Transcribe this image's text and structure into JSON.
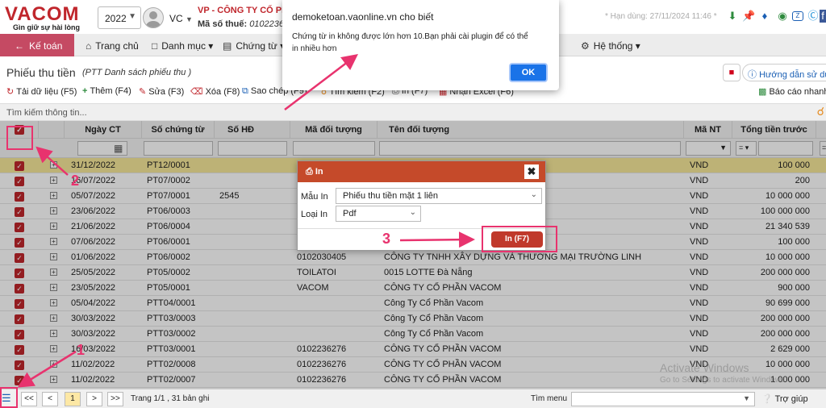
{
  "header": {
    "logo": "VACOM",
    "slogan": "Gìn giữ sự hài lòng",
    "year": "2022",
    "user": "VC",
    "company": "VP - CÔNG TY CỔ PHẦ",
    "tax_label": "Mã số thuế:",
    "tax_value": "010223627",
    "deadline": "* Hạn dùng: 27/11/2024 11:46 *",
    "icons": [
      "download-icon",
      "pin-icon",
      "bell-icon",
      "chat-icon",
      "zalo-icon",
      "skype-icon",
      "facebook-icon"
    ]
  },
  "nav": {
    "back": "Kế toán",
    "items": [
      {
        "label": "Trang chủ",
        "icon": "home-icon"
      },
      {
        "label": "Danh mục",
        "icon": "book-icon"
      },
      {
        "label": "Chứng từ",
        "icon": "file-icon"
      },
      {
        "label": "Hệ thống",
        "icon": "gear-icon"
      }
    ]
  },
  "page": {
    "title": "Phiếu thu tiền",
    "subtitle": "(PTT Danh sách phiếu thu )",
    "guide": "Hướng dẫn sử dụn",
    "report": "Báo cáo nhanh"
  },
  "toolbar": {
    "reload": "Tải dữ liệu (F5)",
    "add": "Thêm (F4)",
    "edit": "Sửa (F3)",
    "delete": "Xóa (F8)",
    "copy": "Sao chép (F9)",
    "find": "Tìm kiếm (F2)",
    "print": "In (F7)",
    "excel": "Nhận Excel (F6)"
  },
  "search": {
    "placeholder": "Tìm kiếm thông tin..."
  },
  "grid": {
    "columns": [
      "Ngày CT",
      "Số chứng từ",
      "Số HĐ",
      "Mã đối tượng",
      "Tên đối tượng",
      "Mã NT",
      "Tổng tiền trước"
    ],
    "filter_ops": [
      "=",
      "="
    ],
    "rows": [
      {
        "date": "31/12/2022",
        "doc": "PT12/0001",
        "inv": "",
        "code": "",
        "name": "",
        "cur": "VND",
        "amount": "100 000"
      },
      {
        "date": "16/07/2022",
        "doc": "PT07/0002",
        "inv": "",
        "code": "",
        "name": "",
        "cur": "VND",
        "amount": "200"
      },
      {
        "date": "05/07/2022",
        "doc": "PT07/0001",
        "inv": "2545",
        "code": "",
        "name": "",
        "cur": "VND",
        "amount": "10 000 000"
      },
      {
        "date": "23/06/2022",
        "doc": "PT06/0003",
        "inv": "",
        "code": "",
        "name": "ANH HẢI PHÒNG",
        "cur": "VND",
        "amount": "100 000 000"
      },
      {
        "date": "21/06/2022",
        "doc": "PT06/0004",
        "inv": "",
        "code": "",
        "name": "",
        "cur": "VND",
        "amount": "21 340 539"
      },
      {
        "date": "07/06/2022",
        "doc": "PT06/0001",
        "inv": "",
        "code": "",
        "name": "",
        "cur": "VND",
        "amount": "100 000"
      },
      {
        "date": "01/06/2022",
        "doc": "PT06/0002",
        "inv": "",
        "code": "0102030405",
        "name": "CÔNG TY TNHH XÂY DỰNG VÀ THƯƠNG MẠI TRƯỜNG LINH",
        "cur": "VND",
        "amount": "10 000 000"
      },
      {
        "date": "25/05/2022",
        "doc": "PT05/0002",
        "inv": "",
        "code": "TOILATOI",
        "name": "0015 LOTTE Đà Nẵng",
        "cur": "VND",
        "amount": "200 000 000"
      },
      {
        "date": "23/05/2022",
        "doc": "PT05/0001",
        "inv": "",
        "code": "VACOM",
        "name": "CÔNG TY CỔ PHẦN VACOM",
        "cur": "VND",
        "amount": "900 000"
      },
      {
        "date": "05/04/2022",
        "doc": "PTT04/0001",
        "inv": "",
        "code": "",
        "name": "Công Ty Cổ Phần Vacom",
        "cur": "VND",
        "amount": "90 699 000"
      },
      {
        "date": "30/03/2022",
        "doc": "PTT03/0003",
        "inv": "",
        "code": "",
        "name": "Công Ty Cổ Phần Vacom",
        "cur": "VND",
        "amount": "200 000 000"
      },
      {
        "date": "30/03/2022",
        "doc": "PTT03/0002",
        "inv": "",
        "code": "",
        "name": "Công Ty Cổ Phần Vacom",
        "cur": "VND",
        "amount": "200 000 000"
      },
      {
        "date": "16/03/2022",
        "doc": "PTT03/0001",
        "inv": "",
        "code": "0102236276",
        "name": "CÔNG TY CỔ PHẦN VACOM",
        "cur": "VND",
        "amount": "2 629 000"
      },
      {
        "date": "11/02/2022",
        "doc": "PTT02/0008",
        "inv": "",
        "code": "0102236276",
        "name": "CÔNG TY CỔ PHẦN VACOM",
        "cur": "VND",
        "amount": "10 000 000"
      },
      {
        "date": "11/02/2022",
        "doc": "PTT02/0007",
        "inv": "",
        "code": "0102236276",
        "name": "CÔNG TY CỔ PHẦN VACOM",
        "cur": "VND",
        "amount": "1 000 000"
      }
    ]
  },
  "pager": {
    "first": "<<",
    "prev": "<",
    "page": "1",
    "next": ">",
    "last": ">>",
    "info": "Trang 1/1 , 31 bản ghi",
    "menu_label": "Tìm menu",
    "help": "Trợ giúp"
  },
  "alert": {
    "host": "demoketoan.vaonline.vn cho biết",
    "message": "Chứng từ in không được lớn hơn 10.Bạn phải cài plugin để có thể in nhiều hơn",
    "ok": "OK"
  },
  "print_dialog": {
    "title": "In",
    "template_label": "Mẫu In",
    "template_value": "Phiếu thu tiền mặt 1 liên",
    "type_label": "Loại In",
    "type_value": "Pdf",
    "print_button": "In (F7)"
  },
  "annotations": {
    "step1": "1",
    "step2": "2",
    "step3": "3"
  },
  "watermark": {
    "line1": "Activate Windows",
    "line2": "Go to Settings to activate Windows."
  },
  "colors": {
    "brand": "#c0262c",
    "annotation": "#e8336e",
    "selected_row": "#f6e89a",
    "ok_button": "#1a73e8"
  }
}
